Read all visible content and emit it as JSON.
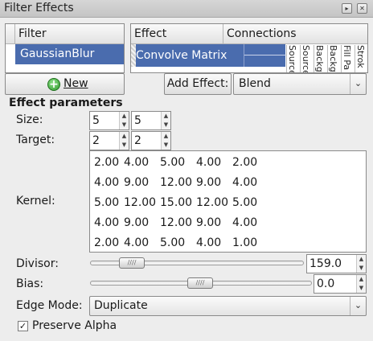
{
  "window": {
    "title": "Filter Effects",
    "buttons": [
      "restore",
      "close"
    ]
  },
  "filter_list": {
    "column_header": "Filter",
    "items": [
      {
        "name": "GaussianBlur",
        "selected": true
      }
    ]
  },
  "effect_list": {
    "column_effect": "Effect",
    "column_connections": "Connections",
    "items": [
      {
        "name": "Convolve Matrix",
        "selected": true
      }
    ],
    "connection_sources": [
      "Source",
      "Source",
      "Backg",
      "Backg",
      "Fill Pa",
      "Strok"
    ]
  },
  "new_button": {
    "label": "New",
    "icon": "plus-circle-icon"
  },
  "add_effect": {
    "label": "Add Effect:",
    "selected": "Blend"
  },
  "params": {
    "heading": "Effect parameters",
    "size_label": "Size:",
    "size_values": [
      "5",
      "5"
    ],
    "target_label": "Target:",
    "target_values": [
      "2",
      "2"
    ],
    "kernel_label": "Kernel:",
    "kernel": [
      [
        "2.00",
        "4.00",
        "5.00",
        "4.00",
        "2.00"
      ],
      [
        "4.00",
        "9.00",
        "12.00",
        "9.00",
        "4.00"
      ],
      [
        "5.00",
        "12.00",
        "15.00",
        "12.00",
        "5.00"
      ],
      [
        "4.00",
        "9.00",
        "12.00",
        "9.00",
        "4.00"
      ],
      [
        "2.00",
        "4.00",
        "5.00",
        "4.00",
        "1.00"
      ]
    ],
    "divisor_label": "Divisor:",
    "divisor_value": "159.0",
    "bias_label": "Bias:",
    "bias_value": "0.0",
    "edge_mode_label": "Edge Mode:",
    "edge_mode_value": "Duplicate",
    "preserve_alpha_label": "Preserve Alpha",
    "preserve_alpha_checked": true
  },
  "colors": {
    "selection": "#4a6cae",
    "background": "#ededed"
  }
}
